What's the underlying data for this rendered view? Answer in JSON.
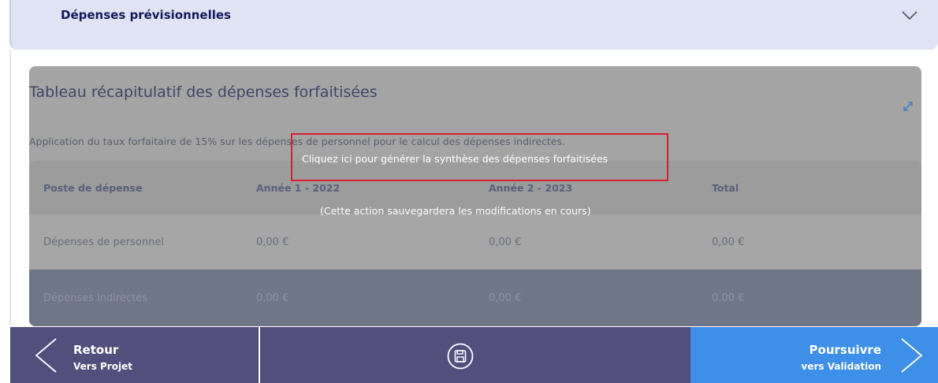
{
  "accordion": {
    "title": "Dépenses prévisionnelles",
    "icon": "chevron-down-icon"
  },
  "card": {
    "title": "Tableau récapitulatif des dépenses forfaitisées",
    "description": "Application du taux forfaitaire de 15% sur les dépenses de personnel pour le calcul des dépenses indirectes.",
    "expand_icon": "expand-icon"
  },
  "table": {
    "columns": [
      "Poste de dépense",
      "Année 1 - 2022",
      "Année 2 - 2023",
      "Total"
    ],
    "rows": [
      [
        "Dépenses de personnel",
        "0,00 €",
        "0,00 €",
        "0,00 €"
      ],
      [
        "Dépenses indirectes",
        "0,00 €",
        "0,00 €",
        "0,00 €"
      ]
    ]
  },
  "overlay": {
    "action": "Cliquez ici pour générer la synthèse des dépenses forfaitisées",
    "note": "(Cette action sauvegardera les modifications en cours)",
    "highlight_color": "#d61f2c"
  },
  "footer": {
    "back": {
      "label": "Retour",
      "sublabel": "Vers Projet"
    },
    "save": {
      "icon": "save-icon"
    },
    "next": {
      "label": "Poursuivre",
      "sublabel": "vers Validation"
    }
  },
  "colors": {
    "primary_dark": "#534f7d",
    "primary_blue": "#3e8fe8",
    "accordion_bg": "#dfe3f3",
    "title_text": "#17195c"
  }
}
